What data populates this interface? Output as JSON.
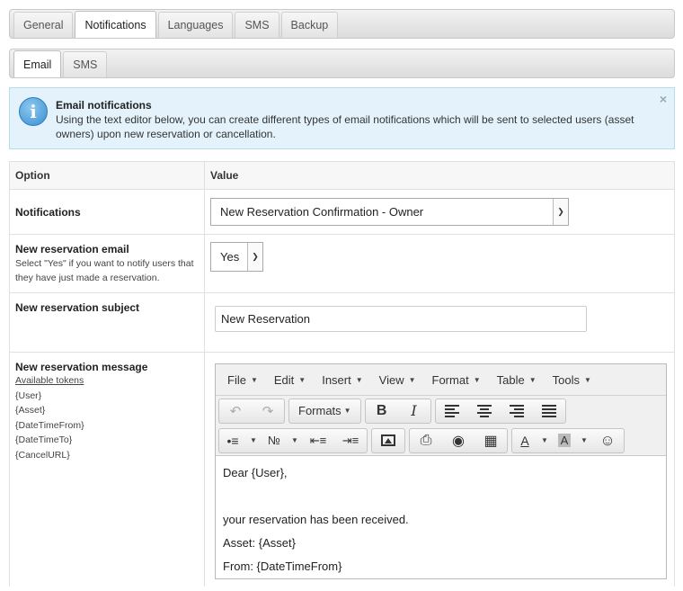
{
  "main_tabs": [
    "General",
    "Notifications",
    "Languages",
    "SMS",
    "Backup"
  ],
  "main_active": 1,
  "sub_tabs": [
    "Email",
    "SMS"
  ],
  "sub_active": 0,
  "info": {
    "title": "Email notifications",
    "text": "Using the text editor below, you can create different types of email notifications which will be sent to selected users (asset owners) upon new reservation or cancellation.",
    "close": "×"
  },
  "table": {
    "col_option": "Option",
    "col_value": "Value"
  },
  "notifications": {
    "label": "Notifications",
    "selected": "New Reservation Confirmation - Owner"
  },
  "new_email": {
    "label": "New reservation email",
    "hint": "Select \"Yes\" if you want to notify users that they have just made a reservation.",
    "selected": "Yes"
  },
  "subject": {
    "label": "New reservation subject",
    "value": "New Reservation"
  },
  "message": {
    "label": "New reservation message",
    "tokens_label": "Available tokens",
    "tokens": [
      "{User}",
      "{Asset}",
      "{DateTimeFrom}",
      "{DateTimeTo}",
      "{CancelURL}"
    ]
  },
  "editor": {
    "menu": [
      "File",
      "Edit",
      "Insert",
      "View",
      "Format",
      "Table",
      "Tools"
    ],
    "formats_label": "Formats",
    "content": [
      "Dear {User},",
      "",
      "your reservation has been received.",
      "Asset: {Asset}",
      "From: {DateTimeFrom}"
    ]
  }
}
